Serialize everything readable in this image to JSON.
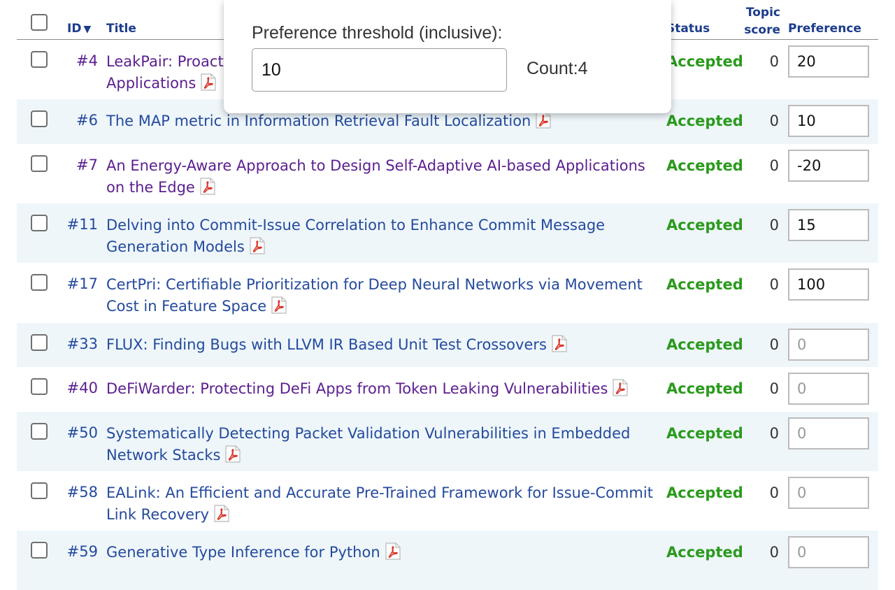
{
  "header": {
    "id_label": "ID",
    "sort_indicator": "▼",
    "title_label": "Title",
    "status_label": "Status",
    "topic_line1": "Topic",
    "topic_line2": "score",
    "preference_label": "Preference"
  },
  "popup": {
    "label": "Preference threshold (inclusive):",
    "threshold_value": "10",
    "count_text": "Count:4"
  },
  "rows": [
    {
      "id": "#4",
      "title_line1": "LeakPair: Proactive Repairing of Memory Leaks in Single Page Web",
      "title_line2": "Applications",
      "status": "Accepted",
      "score": "0",
      "pref_value": "20",
      "pref_placeholder": ""
    },
    {
      "id": "#6",
      "title_line1": "The MAP metric in Information Retrieval Fault Localization",
      "title_line2": "",
      "status": "Accepted",
      "score": "0",
      "pref_value": "10",
      "pref_placeholder": ""
    },
    {
      "id": "#7",
      "title_line1": "An Energy-Aware Approach to Design Self-Adaptive AI-based Applications",
      "title_line2": "on the Edge",
      "status": "Accepted",
      "score": "0",
      "pref_value": "-20",
      "pref_placeholder": ""
    },
    {
      "id": "#11",
      "title_line1": "Delving into Commit-Issue Correlation to Enhance Commit Message",
      "title_line2": "Generation Models",
      "status": "Accepted",
      "score": "0",
      "pref_value": "15",
      "pref_placeholder": ""
    },
    {
      "id": "#17",
      "title_line1": "CertPri: Certifiable Prioritization for Deep Neural Networks via Movement",
      "title_line2": "Cost in Feature Space",
      "status": "Accepted",
      "score": "0",
      "pref_value": "100",
      "pref_placeholder": ""
    },
    {
      "id": "#33",
      "title_line1": "FLUX: Finding Bugs with LLVM IR Based Unit Test Crossovers",
      "title_line2": "",
      "status": "Accepted",
      "score": "0",
      "pref_value": "",
      "pref_placeholder": "0"
    },
    {
      "id": "#40",
      "title_line1": "DeFiWarder: Protecting DeFi Apps from Token Leaking Vulnerabilities",
      "title_line2": "",
      "status": "Accepted",
      "score": "0",
      "pref_value": "",
      "pref_placeholder": "0"
    },
    {
      "id": "#50",
      "title_line1": "Systematically Detecting Packet Validation Vulnerabilities in Embedded",
      "title_line2": "Network Stacks",
      "status": "Accepted",
      "score": "0",
      "pref_value": "",
      "pref_placeholder": "0"
    },
    {
      "id": "#58",
      "title_line1": "EALink: An Efficient and Accurate Pre-Trained Framework for Issue-Commit",
      "title_line2": "Link Recovery",
      "status": "Accepted",
      "score": "0",
      "pref_value": "",
      "pref_placeholder": "0"
    },
    {
      "id": "#59",
      "title_line1": "Generative Type Inference for Python",
      "title_line2": "",
      "status": "Accepted",
      "score": "0",
      "pref_value": "",
      "pref_placeholder": "0"
    }
  ],
  "colors": {
    "link": "#244a9c",
    "visited_link": "#5b1e8f",
    "accepted": "#2a9a1c",
    "header_text": "#1c3c8c",
    "row_alt_bg": "#eef6fa"
  },
  "icons": {
    "pdf": "pdf-icon",
    "sort": "sort-descending-icon"
  }
}
